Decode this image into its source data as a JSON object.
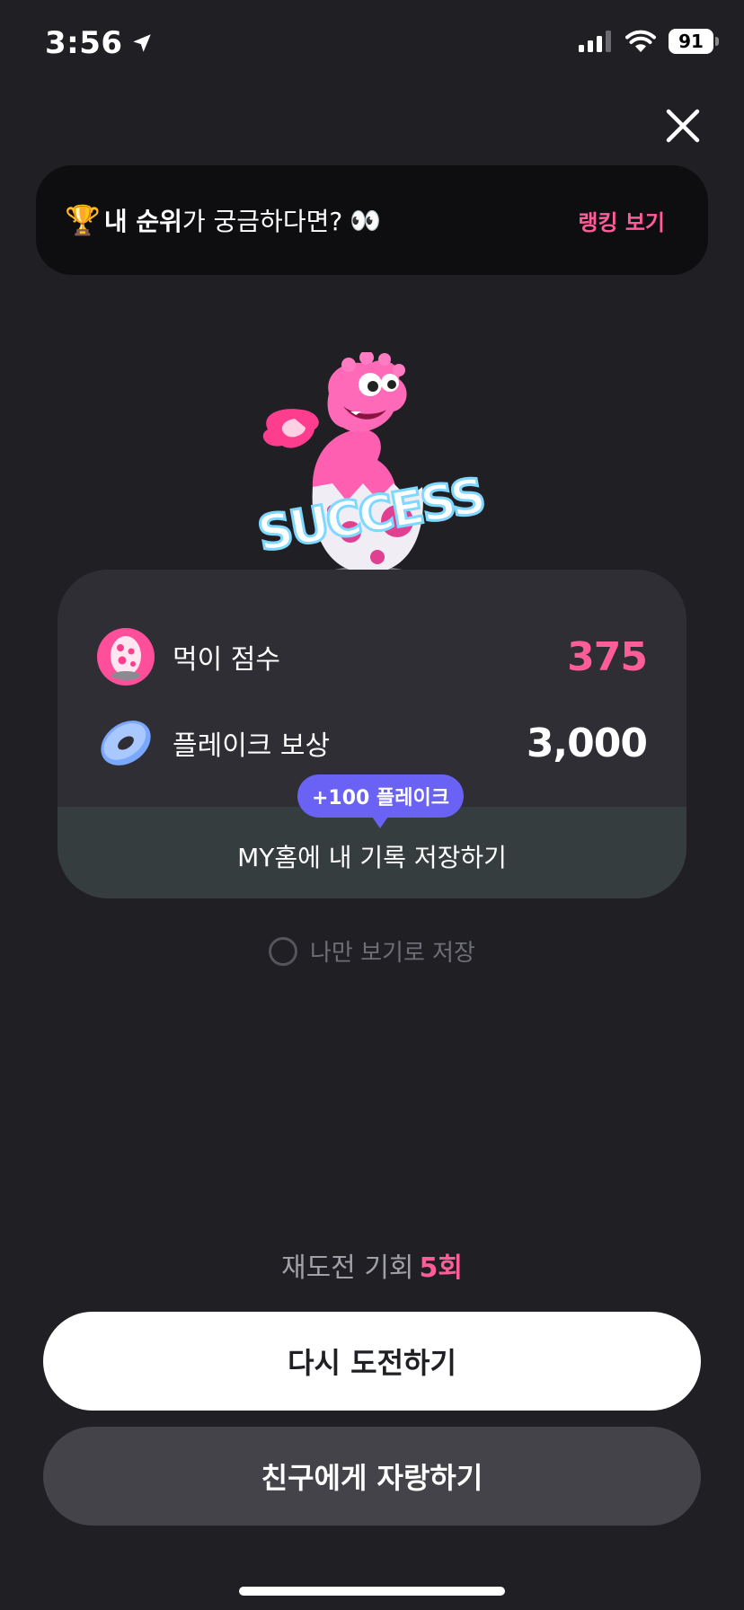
{
  "status_bar": {
    "time": "3:56",
    "battery": "91"
  },
  "icons": {
    "close": "close-icon",
    "location": "location-arrow-icon",
    "signal": "cellular-signal-icon",
    "wifi": "wifi-icon",
    "trophy": "trophy-icon",
    "eyes": "eyes-icon",
    "score": "pink-egg-icon",
    "reward": "blue-donut-icon"
  },
  "ranking_banner": {
    "trophy": "🏆",
    "bold_text": "내 순위",
    "normal_text": "가 궁금하다면?",
    "eyes": "👀",
    "link": "랭킹 보기"
  },
  "mascot": {
    "success_text": "SUCCESS"
  },
  "result": {
    "score_label": "먹이 점수",
    "score_value": "375",
    "reward_label": "플레이크 보상",
    "reward_value": "3,000",
    "bonus_badge": "+100 플레이크",
    "save_label": "MY홈에 내 기록 저장하기"
  },
  "private_save": {
    "label": "나만 보기로 저장",
    "checked": false
  },
  "retry": {
    "prefix": "재도전 기회",
    "count": "5회"
  },
  "buttons": {
    "retry": "다시 도전하기",
    "share": "친구에게 자랑하기"
  },
  "colors": {
    "background": "#1f1f24",
    "accent_pink": "#ff5c9a",
    "bubble_purple": "#6a61f5",
    "card": "#2e2e34"
  }
}
